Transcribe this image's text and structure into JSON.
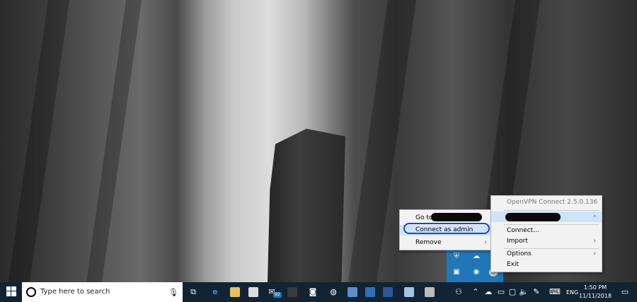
{
  "taskbar": {
    "search_placeholder": "Type here to search",
    "mail_badge": "92",
    "language": "ENG",
    "time": "1:50 PM",
    "date": "11/11/2018"
  },
  "vpn_menu": {
    "header": "OpenVPN Connect 2.5.0.136",
    "items": [
      {
        "label": "Connect..."
      },
      {
        "label": "Import"
      },
      {
        "label": "Options"
      },
      {
        "label": "Exit"
      }
    ]
  },
  "profile_submenu": {
    "items": [
      {
        "label": "Go to"
      },
      {
        "label": "Connect as admin"
      },
      {
        "label": "Remove"
      }
    ]
  },
  "colors": {
    "taskbar": "#122333",
    "tray_overflow": "#1f77b8",
    "menu_highlight": "#cce4f7",
    "annotation_circle": "#2244cc"
  }
}
